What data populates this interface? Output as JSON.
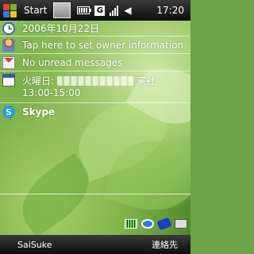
{
  "topbar": {
    "start_label": "Start",
    "time": "17:20",
    "network_badge": "G",
    "icons": [
      "windows-start-icon",
      "app-thumbnail-icon",
      "battery-icon",
      "gprs-icon",
      "signal-icon",
      "volume-icon"
    ]
  },
  "today": {
    "date": "2006年10月22日",
    "owner": "Tap here to set owner information",
    "messages": "No unread messages",
    "calendar": {
      "day": "火曜日:",
      "suffix": "来社",
      "time": "13:00-15:00"
    },
    "skype": "Skype"
  },
  "tray_icons": [
    "battery-status-icon",
    "sync-icon",
    "bluetooth-icon",
    "keyboard-icon"
  ],
  "softkeys": {
    "left": "SaiSuke",
    "right": "連絡先"
  },
  "colors": {
    "bar": "#111111",
    "skype": "#1ea3e0",
    "background": "#6fa34a"
  }
}
